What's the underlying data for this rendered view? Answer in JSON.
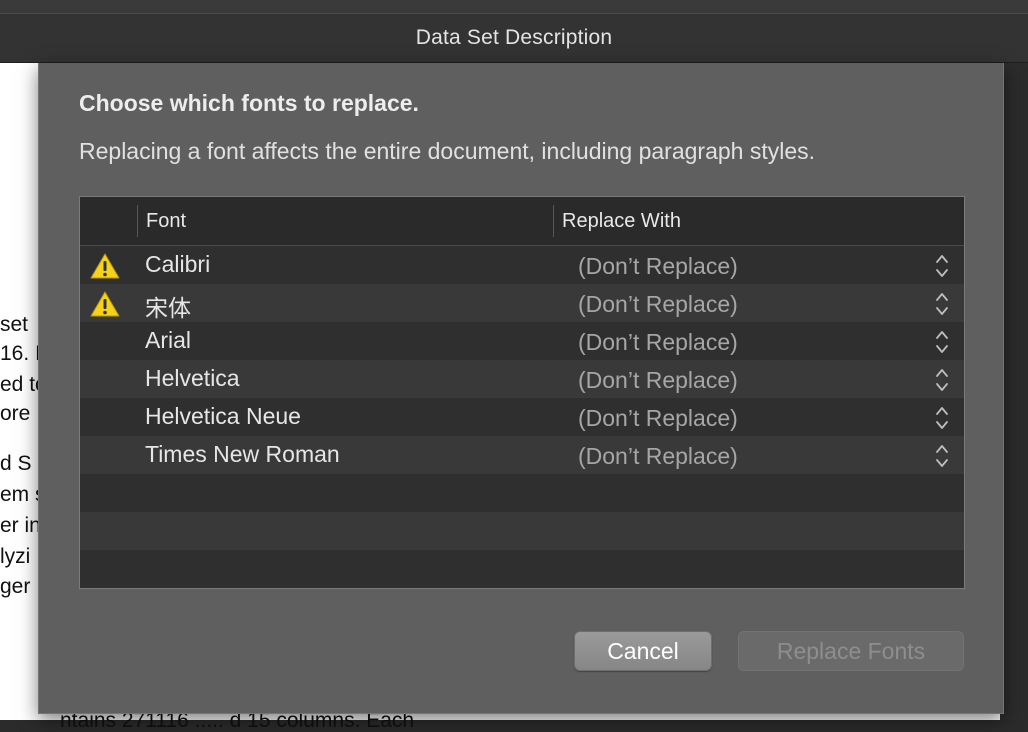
{
  "window": {
    "title": "Data Set Description"
  },
  "document": {
    "fragments": [
      "set",
      "16. I",
      "ed to",
      "ore",
      "d S",
      "em s",
      "er in",
      "lyzi",
      "ger",
      "ntains 271116 ..... d 15 columns. Each"
    ]
  },
  "dialog": {
    "heading": "Choose which fonts to replace.",
    "description": "Replacing a font affects the entire document, including paragraph styles.",
    "table": {
      "columns": {
        "font": "Font",
        "replace_with": "Replace With"
      },
      "rows": [
        {
          "font": "Calibri",
          "replacement": "(Don’t Replace)",
          "warning": true
        },
        {
          "font": "宋体",
          "replacement": "(Don’t Replace)",
          "warning": true
        },
        {
          "font": "Arial",
          "replacement": "(Don’t Replace)",
          "warning": false
        },
        {
          "font": "Helvetica",
          "replacement": "(Don’t Replace)",
          "warning": false
        },
        {
          "font": "Helvetica Neue",
          "replacement": "(Don’t Replace)",
          "warning": false
        },
        {
          "font": "Times New Roman",
          "replacement": "(Don’t Replace)",
          "warning": false
        }
      ]
    },
    "buttons": {
      "cancel": "Cancel",
      "replace": "Replace Fonts"
    },
    "colors": {
      "warning": "#f6d31a",
      "sheet": "#5f5f5f",
      "table": "#2e2e2e"
    }
  }
}
